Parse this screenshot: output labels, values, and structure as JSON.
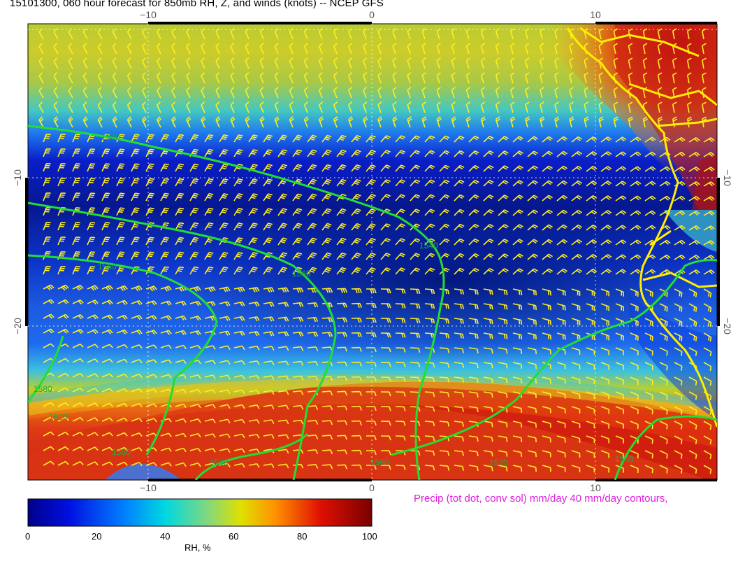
{
  "title": "15101300, 060 hour forecast for 850mb RH, Z, and winds (knots)  -- NCEP GFS",
  "axes": {
    "top_ticks": [
      "−10",
      "0",
      "10"
    ],
    "bottom_ticks": [
      "−10",
      "0",
      "10"
    ],
    "left_ticks": [
      "−10",
      "−20"
    ],
    "right_ticks": [
      "−10",
      "−20"
    ]
  },
  "contour_labels": [
    "1540",
    "1560",
    "1580",
    "1560",
    "1540",
    "1580",
    "1560",
    "1520",
    "1540",
    "1520",
    "1560"
  ],
  "precip_label": "Precip (tot dot, conv sol) mm/day 40 mm/day contours,",
  "colorbar": {
    "title": "RH, %",
    "ticks": [
      "0",
      "20",
      "40",
      "60",
      "80",
      "100"
    ],
    "range": [
      0,
      100
    ]
  },
  "colors": {
    "contour": "#22dd33",
    "barb": "#ffee22",
    "coast": "#ffee00",
    "precip_text": "#e01ee0"
  }
}
